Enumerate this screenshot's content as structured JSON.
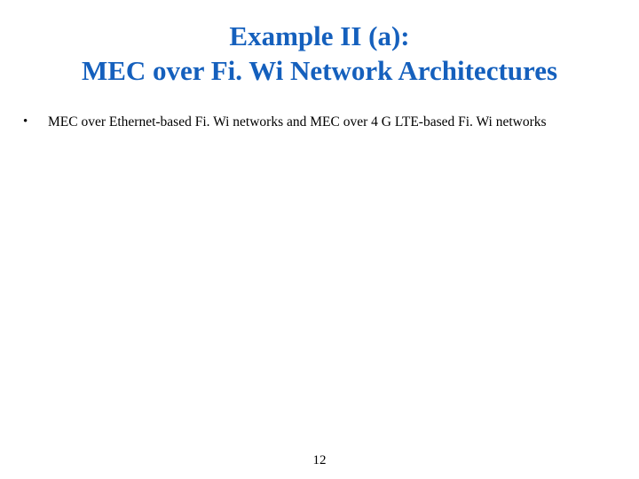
{
  "title": {
    "line1": "Example II (a):",
    "line2": "MEC over Fi. Wi Network Architectures"
  },
  "bullets": {
    "item1": {
      "marker": "•",
      "text": "MEC over Ethernet-based Fi. Wi networks and MEC over 4 G LTE-based Fi. Wi networks"
    }
  },
  "pageNumber": "12"
}
